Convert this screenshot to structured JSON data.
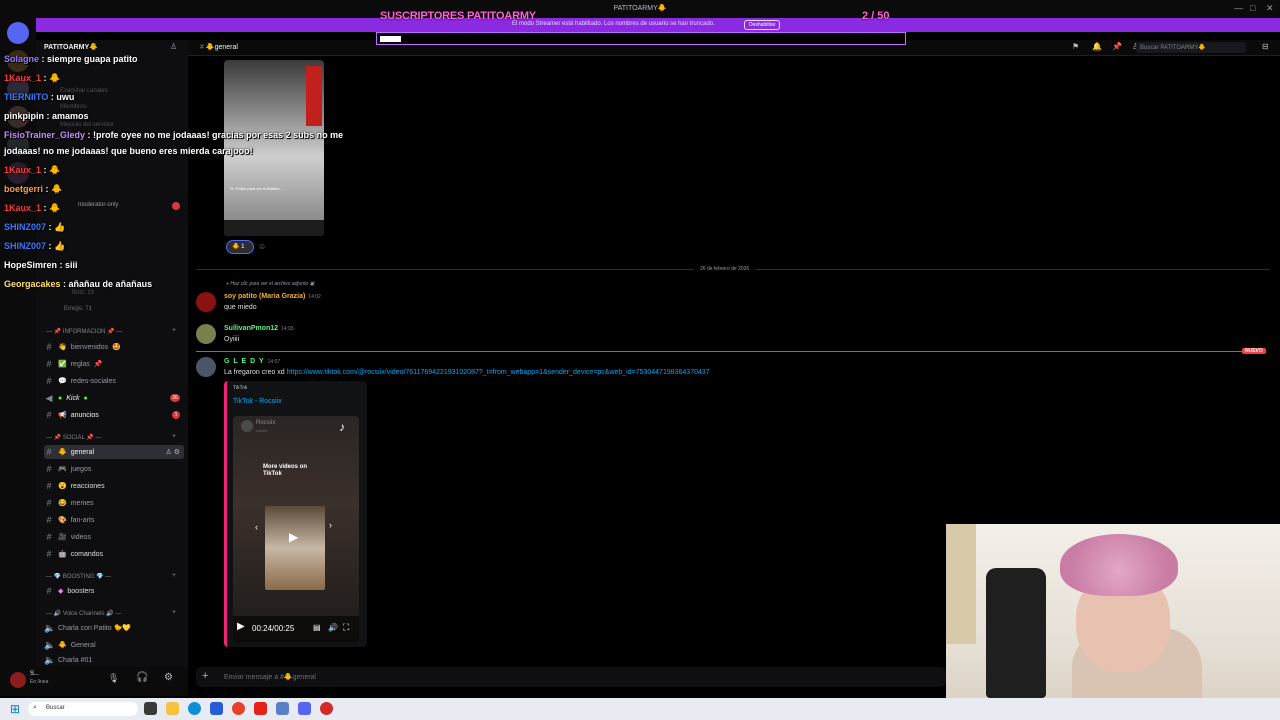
{
  "window": {
    "title": "PATITOARMY🐥",
    "controls": [
      "—",
      "□",
      "✕"
    ]
  },
  "stream": {
    "subs_title": "SUSCRIPTORES PATITOARMY",
    "subs_count": "2  / 50",
    "subs_progress": 0.04,
    "streamer_notice": "El modo Streamer está habilitado. Los nombres de usuario se han truncado.",
    "streamer_notice_button": "Deshabilitar"
  },
  "chat_overlay": [
    {
      "name": "Solagne",
      "text": "siempre guapa patito",
      "color": "#9b7bff"
    },
    {
      "name": "1Kaux_1",
      "text": "🐥",
      "color": "#ff3b3b"
    },
    {
      "name": "TIERNIITO",
      "text": "uwu",
      "color": "#3a7bff"
    },
    {
      "name": "pinkpipin",
      "text": "amamos",
      "color": "#ffffff"
    },
    {
      "name": "FisioTrainer_Gledy",
      "text": "!profe oyee no me jodaaas! gracias por esas 2 subs no me",
      "color": "#c78bff"
    },
    {
      "name": "",
      "text": "jodaaas! no me jodaaas! que bueno eres mierda carajooo!",
      "color": "#ffffff"
    },
    {
      "name": "1Kaux_1",
      "text": "🐥",
      "color": "#ff3b3b"
    },
    {
      "name": "boetgerri",
      "text": "🐥",
      "color": "#ff9f3b"
    },
    {
      "name": "1Kaux_1",
      "text": "🐥",
      "color": "#ff3b3b"
    },
    {
      "name": "SHINZ007",
      "text": "👍",
      "color": "#3a7bff"
    },
    {
      "name": "SHINZ007",
      "text": "👍",
      "color": "#3a7bff"
    },
    {
      "name": "HopeSimren",
      "text": "siii",
      "color": "#ffffff"
    },
    {
      "name": "Georgacakes",
      "text": "añañau de añañaus",
      "color": "#ffe36b"
    }
  ],
  "sidebar": {
    "server_name": "PATITOARMY🐥",
    "faded_items": [
      "Examinar canales",
      "Miembros",
      "Mejoras del servidor",
      "Bots: 19",
      "Emojis: 71"
    ],
    "faded_channel": "moderator-only",
    "categories": {
      "informacion": "INFORMACION",
      "social": "SOCIAL",
      "boosting": "BOOSTING",
      "voice": "Voice Channels"
    },
    "channels_info": [
      {
        "label": "bienvenidos",
        "badge": ""
      },
      {
        "label": "reglas",
        "badge": ""
      },
      {
        "label": "redes-sociales",
        "badge": ""
      },
      {
        "label": "Kick",
        "badge": "26"
      },
      {
        "label": "anuncios",
        "badge": "1"
      }
    ],
    "channels_social": [
      {
        "label": "general",
        "active": true
      },
      {
        "label": "juegos"
      },
      {
        "label": "reacciones"
      },
      {
        "label": "memes"
      },
      {
        "label": "fan-arts"
      },
      {
        "label": "videos"
      },
      {
        "label": "comandos"
      }
    ],
    "channels_boost": [
      {
        "label": "boosters"
      }
    ],
    "voice_channels": [
      {
        "label": "Charla con Patito 🐤💛"
      },
      {
        "label": "General"
      },
      {
        "label": "Charla #01"
      }
    ],
    "user": {
      "name": "S...",
      "status": "En línea"
    }
  },
  "header": {
    "channel": "general",
    "search_placeholder": "Buscar PATITOARMY🐥"
  },
  "messages": {
    "reaction_count": "1",
    "date_divider": "26 de febrero de 2026",
    "reply_hint": "Haz clic para ver el archivo adjunto",
    "m1": {
      "author": "soy patito (Maria Grazia)",
      "time": "14:02",
      "text": "que miedo",
      "color": "#f0b232"
    },
    "m2": {
      "author": "SullivanPmon12",
      "time": "14:03",
      "text": "Oyiiii",
      "color": "#57f287"
    },
    "new_label": "NUEVO",
    "m3": {
      "author": "G L E D Y",
      "time": "14:07",
      "text": "La fregaron creo xd",
      "link": "https://www.tiktok.com/@rocsiix/video/7611769422193102087?_t=from_webapp=1&sender_device=pc&web_id=7530447198364370437",
      "color": "#57f287"
    },
    "embed": {
      "provider": "TikTok",
      "title": "TikTok - Rocsiix",
      "video_author": "Rocsiix",
      "video_handle": "rocsiix",
      "more_videos": "More videos on TikTok",
      "time": "00:24/00:25"
    },
    "attachment_caption": "Si, Patito para ver el Boletin..."
  },
  "composer": {
    "placeholder": "Enviar mensaje a #🐥general"
  },
  "taskbar": {
    "search": "Buscar"
  }
}
